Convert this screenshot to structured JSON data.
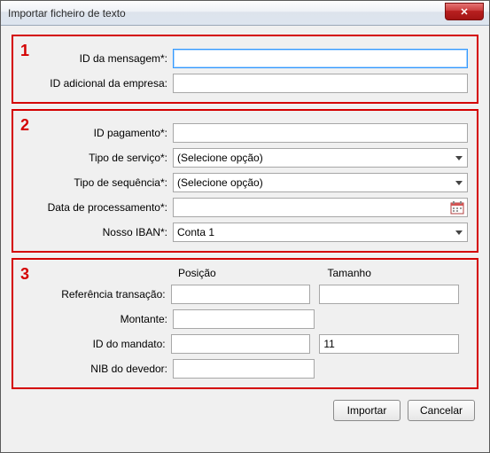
{
  "window": {
    "title": "Importar ficheiro de texto"
  },
  "groups": {
    "g1": {
      "num": "1"
    },
    "g2": {
      "num": "2"
    },
    "g3": {
      "num": "3"
    }
  },
  "labels": {
    "msg_id": "ID da mensagem*:",
    "company_addl_id": "ID adicional da empresa:",
    "payment_id": "ID pagamento*:",
    "service_type": "Tipo de serviço*:",
    "sequence_type": "Tipo de sequência*:",
    "processing_date": "Data de processamento*:",
    "our_iban": "Nosso IBAN*:",
    "position": "Posição",
    "size": "Tamanho",
    "tx_ref": "Referência transação:",
    "amount": "Montante:",
    "mandate_id": "ID do mandato:",
    "debtor_nib": "NIB do devedor:"
  },
  "values": {
    "msg_id": "",
    "company_addl_id": "",
    "payment_id": "",
    "service_type": "(Selecione opção)",
    "sequence_type": "(Selecione opção)",
    "processing_date": "",
    "our_iban": "Conta 1",
    "tx_ref_pos": "",
    "tx_ref_size": "",
    "amount_pos": "",
    "mandate_id_pos": "",
    "mandate_id_size": "11",
    "debtor_nib_pos": ""
  },
  "buttons": {
    "import": "Importar",
    "cancel": "Cancelar"
  }
}
